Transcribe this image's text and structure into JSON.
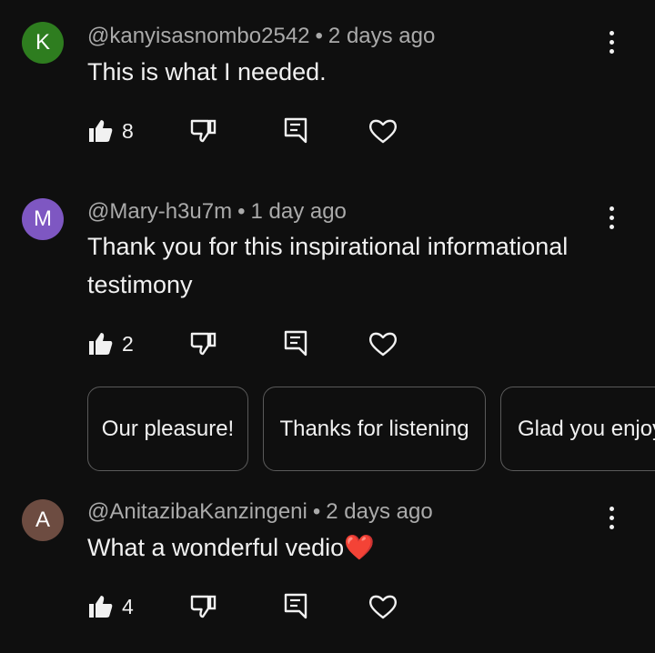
{
  "colors": {
    "background": "#0f0f0f",
    "text": "#f1f1f1",
    "meta": "#aaaaaa",
    "chip_border": "#5a5a5a"
  },
  "comments": [
    {
      "avatar_letter": "K",
      "avatar_color": "#2e7d1f",
      "handle": "@kanyisasnombo2542",
      "separator": "•",
      "time": "2 days ago",
      "text": "This is what I needed.",
      "likes": "8"
    },
    {
      "avatar_letter": "M",
      "avatar_color": "#7e57c2",
      "handle": "@Mary-h3u7m",
      "separator": "•",
      "time": "1 day ago",
      "text": "Thank you for this inspirational informational testimony",
      "likes": "2"
    },
    {
      "avatar_letter": "A",
      "avatar_color": "#6d4c41",
      "handle": "@AnitazibaKanzingeni",
      "separator": "•",
      "time": "2 days ago",
      "text": "What a wonderful vedio",
      "text_emoji": "❤️",
      "likes": "4"
    }
  ],
  "suggested_replies": [
    "Our pleasure!",
    "Thanks for listening",
    "Glad you enjoy"
  ],
  "icons": [
    "like-icon",
    "dislike-icon",
    "reply-icon",
    "heart-icon",
    "more-vert-icon"
  ]
}
